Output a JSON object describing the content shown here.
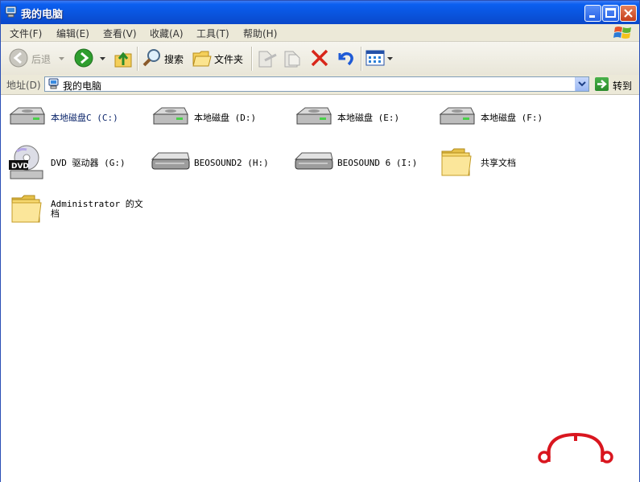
{
  "window": {
    "title": "我的电脑",
    "controls": [
      "minimize",
      "maximize",
      "close"
    ]
  },
  "menu": [
    {
      "label": "文件(F)"
    },
    {
      "label": "编辑(E)"
    },
    {
      "label": "查看(V)"
    },
    {
      "label": "收藏(A)"
    },
    {
      "label": "工具(T)"
    },
    {
      "label": "帮助(H)"
    }
  ],
  "toolbar": {
    "back_label": "后退",
    "search_label": "搜索",
    "folders_label": "文件夹"
  },
  "address": {
    "label": "地址(D)",
    "value": "我的电脑",
    "go_label": "转到"
  },
  "items": [
    {
      "label": "本地磁盘C (C:)",
      "icon": "hard-drive-icon"
    },
    {
      "label": "本地磁盘 (D:)",
      "icon": "hard-drive-icon"
    },
    {
      "label": "本地磁盘 (E:)",
      "icon": "hard-drive-icon"
    },
    {
      "label": "本地磁盘 (F:)",
      "icon": "hard-drive-icon"
    },
    {
      "label": "DVD 驱动器 (G:)",
      "icon": "dvd-drive-icon"
    },
    {
      "label": "BEOSOUND2 (H:)",
      "icon": "removable-drive-icon"
    },
    {
      "label": "BEOSOUND 6 (I:)",
      "icon": "removable-drive-icon"
    },
    {
      "label": "共享文档",
      "icon": "folder-icon"
    },
    {
      "label": "Administrator 的文档",
      "icon": "folder-icon"
    }
  ],
  "colors": {
    "title_bar": "#0a53dc",
    "chrome": "#ece9d8",
    "watermark": "#d9161f"
  }
}
